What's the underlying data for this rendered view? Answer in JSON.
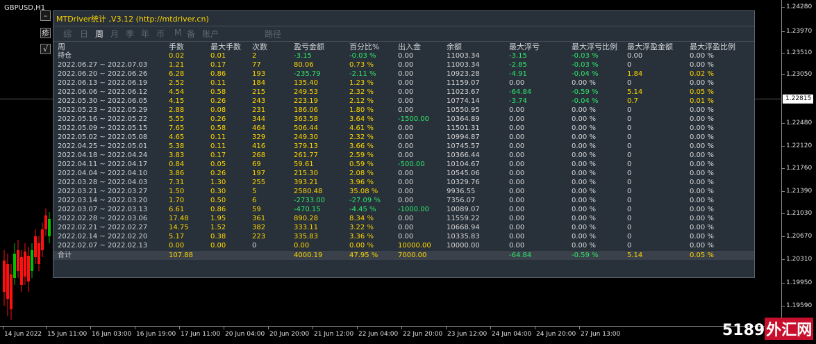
{
  "symbol": "GBPUSD,H1",
  "panel": {
    "title": "MTDriver统计 ,V3.12 (http://mtdriver.cn)",
    "tabs": [
      {
        "label": "综",
        "active": false
      },
      {
        "label": "日",
        "active": false
      },
      {
        "label": "周",
        "active": true
      },
      {
        "label": "月",
        "active": false
      },
      {
        "label": "季",
        "active": false
      },
      {
        "label": "年",
        "active": false
      },
      {
        "label": "币",
        "active": false
      },
      {
        "label": "M",
        "active": false
      },
      {
        "label": "备",
        "active": false
      },
      {
        "label": "账户",
        "active": false
      },
      {
        "label": "路径",
        "active": false
      }
    ],
    "side_buttons": [
      "–",
      "疹",
      "√"
    ],
    "columns": [
      "周",
      "手数",
      "最大手数",
      "次数",
      "盈亏金额",
      "百分比%",
      "出入金",
      "余额",
      "最大浮亏",
      "最大浮亏比例",
      "最大浮盈金额",
      "最大浮盈比例"
    ],
    "holding": {
      "label": "持仓",
      "lots": "0.02",
      "max_lots": "0.01",
      "count": "2",
      "pnl": "-3.15",
      "pct": "-0.03 %",
      "inout": "0.00",
      "balance": "11003.34",
      "max_dd": "-3.15",
      "max_dd_pct": "-0.03 %",
      "max_fp": "0.00",
      "max_fp_pct": "0.00 %"
    },
    "rows": [
      {
        "week": "2022.06.27 ~ 2022.07.03",
        "lots": "1.21",
        "max_lots": "0.17",
        "count": "77",
        "pnl": "80.06",
        "pct": "0.73 %",
        "inout": "0.00",
        "balance": "11003.34",
        "max_dd": "-2.85",
        "max_dd_pct": "-0.03 %",
        "max_fp": "0",
        "max_fp_pct": "0.00 %"
      },
      {
        "week": "2022.06.20 ~ 2022.06.26",
        "lots": "6.28",
        "max_lots": "0.86",
        "count": "193",
        "pnl": "-235.79",
        "pct": "-2.11 %",
        "inout": "0.00",
        "balance": "10923.28",
        "max_dd": "-4.91",
        "max_dd_pct": "-0.04 %",
        "max_fp": "1.84",
        "max_fp_pct": "0.02 %"
      },
      {
        "week": "2022.06.13 ~ 2022.06.19",
        "lots": "2.52",
        "max_lots": "0.11",
        "count": "184",
        "pnl": "135.40",
        "pct": "1.23 %",
        "inout": "0.00",
        "balance": "11159.07",
        "max_dd": "0.00",
        "max_dd_pct": "0.00 %",
        "max_fp": "0",
        "max_fp_pct": "0.00 %"
      },
      {
        "week": "2022.06.06 ~ 2022.06.12",
        "lots": "4.54",
        "max_lots": "0.58",
        "count": "215",
        "pnl": "249.53",
        "pct": "2.32 %",
        "inout": "0.00",
        "balance": "11023.67",
        "max_dd": "-64.84",
        "max_dd_pct": "-0.59 %",
        "max_fp": "5.14",
        "max_fp_pct": "0.05 %"
      },
      {
        "week": "2022.05.30 ~ 2022.06.05",
        "lots": "4.15",
        "max_lots": "0.26",
        "count": "243",
        "pnl": "223.19",
        "pct": "2.12 %",
        "inout": "0.00",
        "balance": "10774.14",
        "max_dd": "-3.74",
        "max_dd_pct": "-0.04 %",
        "max_fp": "0.7",
        "max_fp_pct": "0.01 %"
      },
      {
        "week": "2022.05.23 ~ 2022.05.29",
        "lots": "2.88",
        "max_lots": "0.08",
        "count": "231",
        "pnl": "186.06",
        "pct": "1.80 %",
        "inout": "0.00",
        "balance": "10550.95",
        "max_dd": "0.00",
        "max_dd_pct": "0.00 %",
        "max_fp": "0",
        "max_fp_pct": "0.00 %"
      },
      {
        "week": "2022.05.16 ~ 2022.05.22",
        "lots": "5.55",
        "max_lots": "0.26",
        "count": "344",
        "pnl": "363.58",
        "pct": "3.64 %",
        "inout": "-1500.00",
        "balance": "10364.89",
        "max_dd": "0.00",
        "max_dd_pct": "0.00 %",
        "max_fp": "0",
        "max_fp_pct": "0.00 %"
      },
      {
        "week": "2022.05.09 ~ 2022.05.15",
        "lots": "7.65",
        "max_lots": "0.58",
        "count": "464",
        "pnl": "506.44",
        "pct": "4.61 %",
        "inout": "0.00",
        "balance": "11501.31",
        "max_dd": "0.00",
        "max_dd_pct": "0.00 %",
        "max_fp": "0",
        "max_fp_pct": "0.00 %"
      },
      {
        "week": "2022.05.02 ~ 2022.05.08",
        "lots": "4.65",
        "max_lots": "0.11",
        "count": "329",
        "pnl": "249.30",
        "pct": "2.32 %",
        "inout": "0.00",
        "balance": "10994.87",
        "max_dd": "0.00",
        "max_dd_pct": "0.00 %",
        "max_fp": "0",
        "max_fp_pct": "0.00 %"
      },
      {
        "week": "2022.04.25 ~ 2022.05.01",
        "lots": "5.38",
        "max_lots": "0.11",
        "count": "416",
        "pnl": "379.13",
        "pct": "3.66 %",
        "inout": "0.00",
        "balance": "10745.57",
        "max_dd": "0.00",
        "max_dd_pct": "0.00 %",
        "max_fp": "0",
        "max_fp_pct": "0.00 %"
      },
      {
        "week": "2022.04.18 ~ 2022.04.24",
        "lots": "3.83",
        "max_lots": "0.17",
        "count": "268",
        "pnl": "261.77",
        "pct": "2.59 %",
        "inout": "0.00",
        "balance": "10366.44",
        "max_dd": "0.00",
        "max_dd_pct": "0.00 %",
        "max_fp": "0",
        "max_fp_pct": "0.00 %"
      },
      {
        "week": "2022.04.11 ~ 2022.04.17",
        "lots": "0.84",
        "max_lots": "0.05",
        "count": "69",
        "pnl": "59.61",
        "pct": "0.59 %",
        "inout": "-500.00",
        "balance": "10104.67",
        "max_dd": "0.00",
        "max_dd_pct": "0.00 %",
        "max_fp": "0",
        "max_fp_pct": "0.00 %"
      },
      {
        "week": "2022.04.04 ~ 2022.04.10",
        "lots": "3.86",
        "max_lots": "0.26",
        "count": "197",
        "pnl": "215.30",
        "pct": "2.08 %",
        "inout": "0.00",
        "balance": "10545.06",
        "max_dd": "0.00",
        "max_dd_pct": "0.00 %",
        "max_fp": "0",
        "max_fp_pct": "0.00 %"
      },
      {
        "week": "2022.03.28 ~ 2022.04.03",
        "lots": "7.31",
        "max_lots": "1.30",
        "count": "255",
        "pnl": "393.21",
        "pct": "3.96 %",
        "inout": "0.00",
        "balance": "10329.76",
        "max_dd": "0.00",
        "max_dd_pct": "0.00 %",
        "max_fp": "0",
        "max_fp_pct": "0.00 %"
      },
      {
        "week": "2022.03.21 ~ 2022.03.27",
        "lots": "1.50",
        "max_lots": "0.30",
        "count": "5",
        "pnl": "2580.48",
        "pct": "35.08 %",
        "inout": "0.00",
        "balance": "9936.55",
        "max_dd": "0.00",
        "max_dd_pct": "0.00 %",
        "max_fp": "0",
        "max_fp_pct": "0.00 %"
      },
      {
        "week": "2022.03.14 ~ 2022.03.20",
        "lots": "1.70",
        "max_lots": "0.50",
        "count": "6",
        "pnl": "-2733.00",
        "pct": "-27.09 %",
        "inout": "0.00",
        "balance": "7356.07",
        "max_dd": "0.00",
        "max_dd_pct": "0.00 %",
        "max_fp": "0",
        "max_fp_pct": "0.00 %"
      },
      {
        "week": "2022.03.07 ~ 2022.03.13",
        "lots": "6.61",
        "max_lots": "0.86",
        "count": "59",
        "pnl": "-470.15",
        "pct": "-4.45 %",
        "inout": "-1000.00",
        "balance": "10089.07",
        "max_dd": "0.00",
        "max_dd_pct": "0.00 %",
        "max_fp": "0",
        "max_fp_pct": "0.00 %"
      },
      {
        "week": "2022.02.28 ~ 2022.03.06",
        "lots": "17.48",
        "max_lots": "1.95",
        "count": "361",
        "pnl": "890.28",
        "pct": "8.34 %",
        "inout": "0.00",
        "balance": "11559.22",
        "max_dd": "0.00",
        "max_dd_pct": "0.00 %",
        "max_fp": "0",
        "max_fp_pct": "0.00 %"
      },
      {
        "week": "2022.02.21 ~ 2022.02.27",
        "lots": "14.75",
        "max_lots": "1.52",
        "count": "382",
        "pnl": "333.11",
        "pct": "3.22 %",
        "inout": "0.00",
        "balance": "10668.94",
        "max_dd": "0.00",
        "max_dd_pct": "0.00 %",
        "max_fp": "0",
        "max_fp_pct": "0.00 %"
      },
      {
        "week": "2022.02.14 ~ 2022.02.20",
        "lots": "5.17",
        "max_lots": "0.38",
        "count": "223",
        "pnl": "335.83",
        "pct": "3.36 %",
        "inout": "0.00",
        "balance": "10335.83",
        "max_dd": "0.00",
        "max_dd_pct": "0.00 %",
        "max_fp": "0",
        "max_fp_pct": "0.00 %"
      },
      {
        "week": "2022.02.07 ~ 2022.02.13",
        "lots": "0.00",
        "max_lots": "0.00",
        "count": "0",
        "pnl": "0.00",
        "pct": "0.00 %",
        "inout": "10000.00",
        "balance": "10000.00",
        "max_dd": "0.00",
        "max_dd_pct": "0.00 %",
        "max_fp": "0",
        "max_fp_pct": "0.00 %"
      }
    ],
    "total": {
      "label": "合计",
      "lots": "107.88",
      "pnl": "4000.19",
      "pct": "47.95 %",
      "inout": "7000.00",
      "max_dd": "-64.84",
      "max_dd_pct": "-0.59 %",
      "max_fp": "5.14",
      "max_fp_pct": "0.05 %"
    }
  },
  "price_axis": [
    "1.24280",
    "1.23970",
    "1.23510",
    "1.23050",
    "1.22815",
    "1.22480",
    "1.22120",
    "1.21760",
    "1.21390",
    "1.21030",
    "1.20670",
    "1.20310",
    "1.19950",
    "1.19590"
  ],
  "price_current": "1.22815",
  "time_axis": [
    "14 Jun 2022",
    "15 Jun 11:00",
    "16 Jun 03:00",
    "16 Jun 19:00",
    "17 Jun 11:00",
    "20 Jun 04:00",
    "20 Jun 20:00",
    "21 Jun 12:00",
    "22 Jun 04:00",
    "22 Jun 20:00",
    "23 Jun 12:00",
    "24 Jun 04:00",
    "24 Jun 20:00",
    "27 Jun 13:00"
  ],
  "watermark": {
    "text": "5189",
    "box": "外汇网"
  },
  "colors": {
    "bull": "#00c000",
    "bear": "#ff1010",
    "panel_bg": "#283039",
    "yellow": "#ffd700",
    "green": "#2ee86a"
  }
}
